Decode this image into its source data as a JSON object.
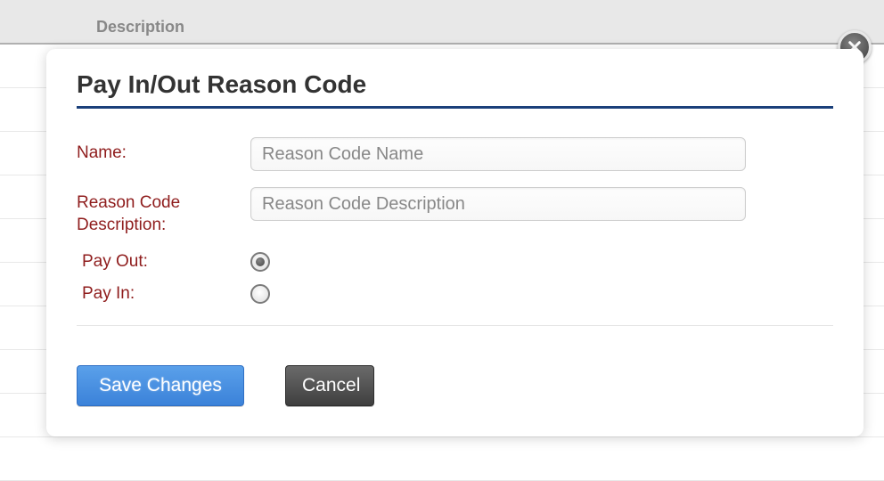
{
  "background": {
    "column_header": "Description"
  },
  "modal": {
    "title": "Pay In/Out Reason Code",
    "fields": {
      "name": {
        "label": "Name:",
        "placeholder": "Reason Code Name",
        "value": ""
      },
      "description": {
        "label": "Reason Code Description:",
        "placeholder": "Reason Code Description",
        "value": ""
      },
      "pay_out": {
        "label": "Pay Out:",
        "checked": true
      },
      "pay_in": {
        "label": "Pay In:",
        "checked": false
      }
    },
    "buttons": {
      "save": "Save Changes",
      "cancel": "Cancel"
    }
  }
}
